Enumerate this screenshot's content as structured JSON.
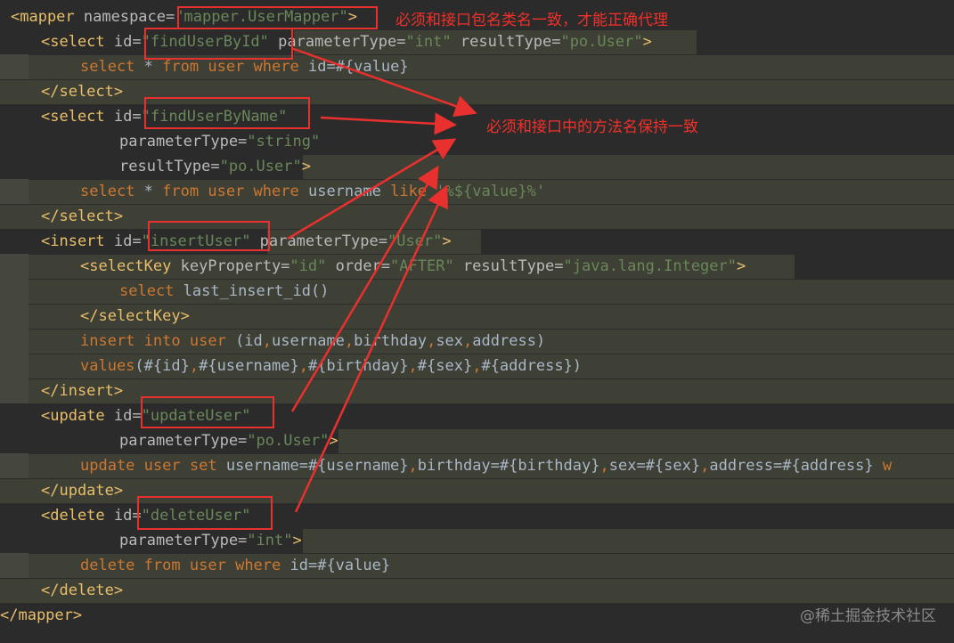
{
  "colors": {
    "background": "#2b2b2b",
    "line_highlight": "#3e3f35",
    "tag": "#e8bf6a",
    "attr": "#bababa",
    "string": "#6a8759",
    "keyword": "#cc7832",
    "plain": "#a9b7c6",
    "annotation": "#e8312e"
  },
  "code_lines": [
    {
      "segs": [
        {
          "t": "<mapper",
          "c": "tag"
        },
        {
          "t": " namespace=",
          "c": "attr"
        },
        {
          "t": "\"mapper.UserMapper\"",
          "c": "str"
        },
        {
          "t": ">",
          "c": "tag"
        }
      ]
    },
    {
      "segs": [
        {
          "t": "<select",
          "c": "tag"
        },
        {
          "t": " id=",
          "c": "attr"
        },
        {
          "t": "\"findUserById\"",
          "c": "str"
        },
        {
          "t": " parameterType=",
          "c": "attr"
        },
        {
          "t": "\"int\"",
          "c": "str"
        },
        {
          "t": " resultType=",
          "c": "attr"
        },
        {
          "t": "\"po.User\"",
          "c": "str"
        },
        {
          "t": ">",
          "c": "tag"
        }
      ]
    },
    {
      "segs": [
        {
          "t": "select",
          "c": "kw"
        },
        {
          "t": " * ",
          "c": "plain"
        },
        {
          "t": "from",
          "c": "kw"
        },
        {
          "t": " ",
          "c": "plain"
        },
        {
          "t": "user",
          "c": "kw"
        },
        {
          "t": " ",
          "c": "plain"
        },
        {
          "t": "where",
          "c": "kw"
        },
        {
          "t": " id=#{value}",
          "c": "plain"
        }
      ]
    },
    {
      "segs": [
        {
          "t": "</select>",
          "c": "tag"
        }
      ]
    },
    {
      "segs": [
        {
          "t": "<select",
          "c": "tag"
        },
        {
          "t": " id=",
          "c": "attr"
        },
        {
          "t": "\"findUserByName\"",
          "c": "str"
        }
      ]
    },
    {
      "segs": [
        {
          "t": "parameterType=",
          "c": "attr"
        },
        {
          "t": "\"string\"",
          "c": "str"
        }
      ]
    },
    {
      "segs": [
        {
          "t": "resultType=",
          "c": "attr"
        },
        {
          "t": "\"po.User\"",
          "c": "str"
        },
        {
          "t": ">",
          "c": "tag"
        }
      ]
    },
    {
      "segs": [
        {
          "t": "select",
          "c": "kw"
        },
        {
          "t": " * ",
          "c": "plain"
        },
        {
          "t": "from",
          "c": "kw"
        },
        {
          "t": " ",
          "c": "plain"
        },
        {
          "t": "user",
          "c": "kw"
        },
        {
          "t": " ",
          "c": "plain"
        },
        {
          "t": "where",
          "c": "kw"
        },
        {
          "t": " username ",
          "c": "plain"
        },
        {
          "t": "like",
          "c": "kw"
        },
        {
          "t": " ",
          "c": "plain"
        },
        {
          "t": "'%${value}%'",
          "c": "str"
        }
      ]
    },
    {
      "segs": [
        {
          "t": "</select>",
          "c": "tag"
        }
      ]
    },
    {
      "segs": [
        {
          "t": "<insert",
          "c": "tag"
        },
        {
          "t": " id=",
          "c": "attr"
        },
        {
          "t": "\"insertUser\"",
          "c": "str"
        },
        {
          "t": " parameterType=",
          "c": "attr"
        },
        {
          "t": "\"User\"",
          "c": "str"
        },
        {
          "t": ">",
          "c": "tag"
        }
      ]
    },
    {
      "segs": [
        {
          "t": "<selectKey",
          "c": "tag"
        },
        {
          "t": " keyProperty=",
          "c": "attr"
        },
        {
          "t": "\"id\"",
          "c": "str"
        },
        {
          "t": " order=",
          "c": "attr"
        },
        {
          "t": "\"AFTER\"",
          "c": "str"
        },
        {
          "t": " resultType=",
          "c": "attr"
        },
        {
          "t": "\"java.lang.Integer\"",
          "c": "str"
        },
        {
          "t": ">",
          "c": "tag"
        }
      ]
    },
    {
      "segs": [
        {
          "t": "select",
          "c": "kw"
        },
        {
          "t": " last_insert_id()",
          "c": "plain"
        }
      ]
    },
    {
      "segs": [
        {
          "t": "</selectKey>",
          "c": "tag"
        }
      ]
    },
    {
      "segs": [
        {
          "t": "insert",
          "c": "kw"
        },
        {
          "t": " ",
          "c": "plain"
        },
        {
          "t": "into",
          "c": "kw"
        },
        {
          "t": " ",
          "c": "plain"
        },
        {
          "t": "user",
          "c": "kw"
        },
        {
          "t": " (id",
          "c": "plain"
        },
        {
          "t": ",",
          "c": "kw"
        },
        {
          "t": "username",
          "c": "plain"
        },
        {
          "t": ",",
          "c": "kw"
        },
        {
          "t": "birthday",
          "c": "plain"
        },
        {
          "t": ",",
          "c": "kw"
        },
        {
          "t": "sex",
          "c": "plain"
        },
        {
          "t": ",",
          "c": "kw"
        },
        {
          "t": "address)",
          "c": "plain"
        }
      ]
    },
    {
      "segs": [
        {
          "t": "values",
          "c": "kw"
        },
        {
          "t": "(#{id}",
          "c": "plain"
        },
        {
          "t": ",",
          "c": "kw"
        },
        {
          "t": "#{username}",
          "c": "plain"
        },
        {
          "t": ",",
          "c": "kw"
        },
        {
          "t": "#{birthday}",
          "c": "plain"
        },
        {
          "t": ",",
          "c": "kw"
        },
        {
          "t": "#{sex}",
          "c": "plain"
        },
        {
          "t": ",",
          "c": "kw"
        },
        {
          "t": "#{address})",
          "c": "plain"
        }
      ]
    },
    {
      "segs": [
        {
          "t": "</insert>",
          "c": "tag"
        }
      ]
    },
    {
      "segs": [
        {
          "t": "<update",
          "c": "tag"
        },
        {
          "t": " id=",
          "c": "attr"
        },
        {
          "t": "\"updateUser\"",
          "c": "str"
        }
      ]
    },
    {
      "segs": [
        {
          "t": "parameterType=",
          "c": "attr"
        },
        {
          "t": "\"po.User\"",
          "c": "str"
        },
        {
          "t": ">",
          "c": "tag"
        }
      ]
    },
    {
      "segs": [
        {
          "t": "update",
          "c": "kw"
        },
        {
          "t": " ",
          "c": "plain"
        },
        {
          "t": "user",
          "c": "kw"
        },
        {
          "t": " ",
          "c": "plain"
        },
        {
          "t": "set",
          "c": "kw"
        },
        {
          "t": " username=#{username}",
          "c": "plain"
        },
        {
          "t": ",",
          "c": "kw"
        },
        {
          "t": "birthday=#{birthday}",
          "c": "plain"
        },
        {
          "t": ",",
          "c": "kw"
        },
        {
          "t": "sex=#{sex}",
          "c": "plain"
        },
        {
          "t": ",",
          "c": "kw"
        },
        {
          "t": "address=#{address}",
          "c": "plain"
        },
        {
          "t": " w",
          "c": "kw"
        }
      ]
    },
    {
      "segs": [
        {
          "t": "</update>",
          "c": "tag"
        }
      ]
    },
    {
      "segs": [
        {
          "t": "<delete",
          "c": "tag"
        },
        {
          "t": " id=",
          "c": "attr"
        },
        {
          "t": "\"deleteUser\"",
          "c": "str"
        }
      ]
    },
    {
      "segs": [
        {
          "t": "parameterType=",
          "c": "attr"
        },
        {
          "t": "\"int\"",
          "c": "str"
        },
        {
          "t": ">",
          "c": "tag"
        }
      ]
    },
    {
      "segs": [
        {
          "t": "delete",
          "c": "kw"
        },
        {
          "t": " ",
          "c": "plain"
        },
        {
          "t": "from",
          "c": "kw"
        },
        {
          "t": " ",
          "c": "plain"
        },
        {
          "t": "user",
          "c": "kw"
        },
        {
          "t": " ",
          "c": "plain"
        },
        {
          "t": "where",
          "c": "kw"
        },
        {
          "t": " id=#{value}",
          "c": "plain"
        }
      ]
    },
    {
      "segs": [
        {
          "t": "</delete>",
          "c": "tag"
        }
      ]
    },
    {
      "segs": [
        {
          "t": "</mapper>",
          "c": "tag"
        }
      ]
    }
  ],
  "annotations": {
    "namespace_note": "必须和接口包名类名一致，才能正确代理",
    "method_note": "必须和接口中的方法名保持一致"
  },
  "watermark": "@稀土掘金技术社区"
}
